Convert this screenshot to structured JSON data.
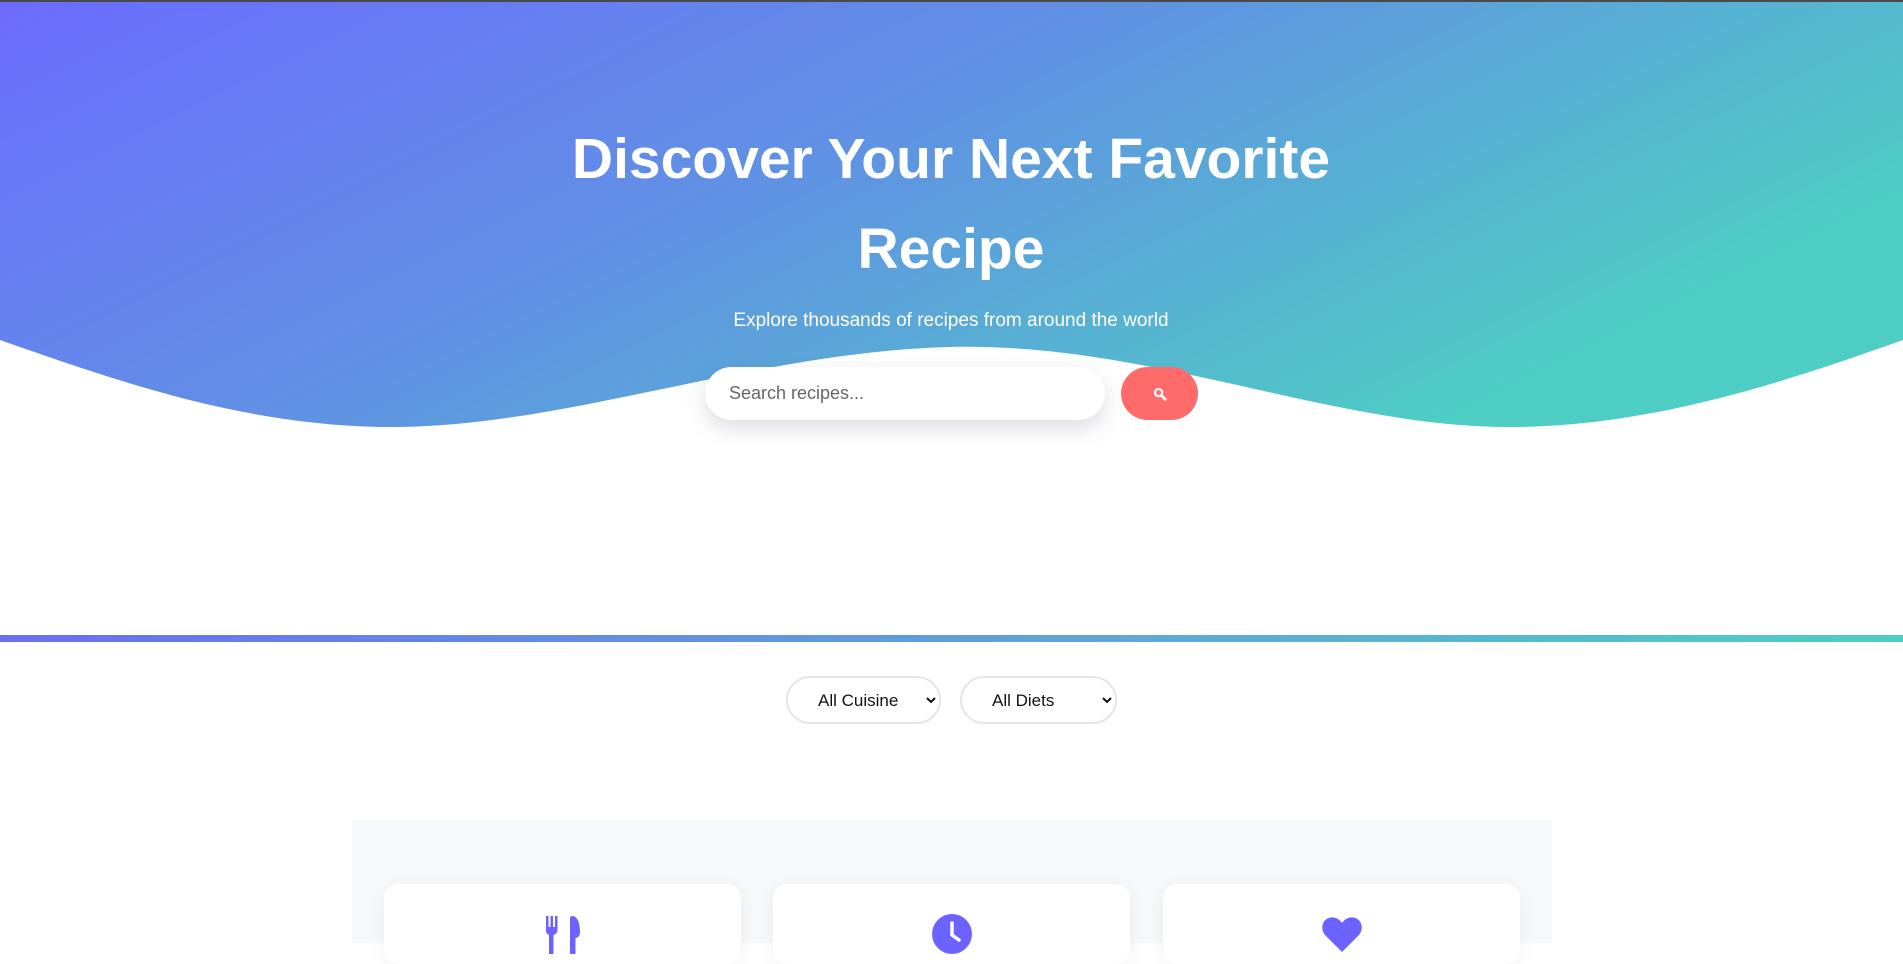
{
  "hero": {
    "title": "Discover Your Next Favorite Recipe",
    "subtitle": "Explore thousands of recipes from around the world",
    "gradient_start": "#6c6cff",
    "gradient_end": "#4ecdc4"
  },
  "search": {
    "placeholder": "Search recipes...",
    "button_color": "#ff6b6b",
    "button_icon": "search-icon"
  },
  "filters": {
    "cuisine": {
      "selected": "All Cuisines",
      "options": [
        "All Cuisines"
      ]
    },
    "diet": {
      "selected": "All Diets",
      "options": [
        "All Diets"
      ]
    }
  },
  "features": {
    "cards": [
      {
        "icon": "utensils-icon"
      },
      {
        "icon": "clock-icon"
      },
      {
        "icon": "heart-icon"
      }
    ],
    "accent": "#6c63ff"
  }
}
